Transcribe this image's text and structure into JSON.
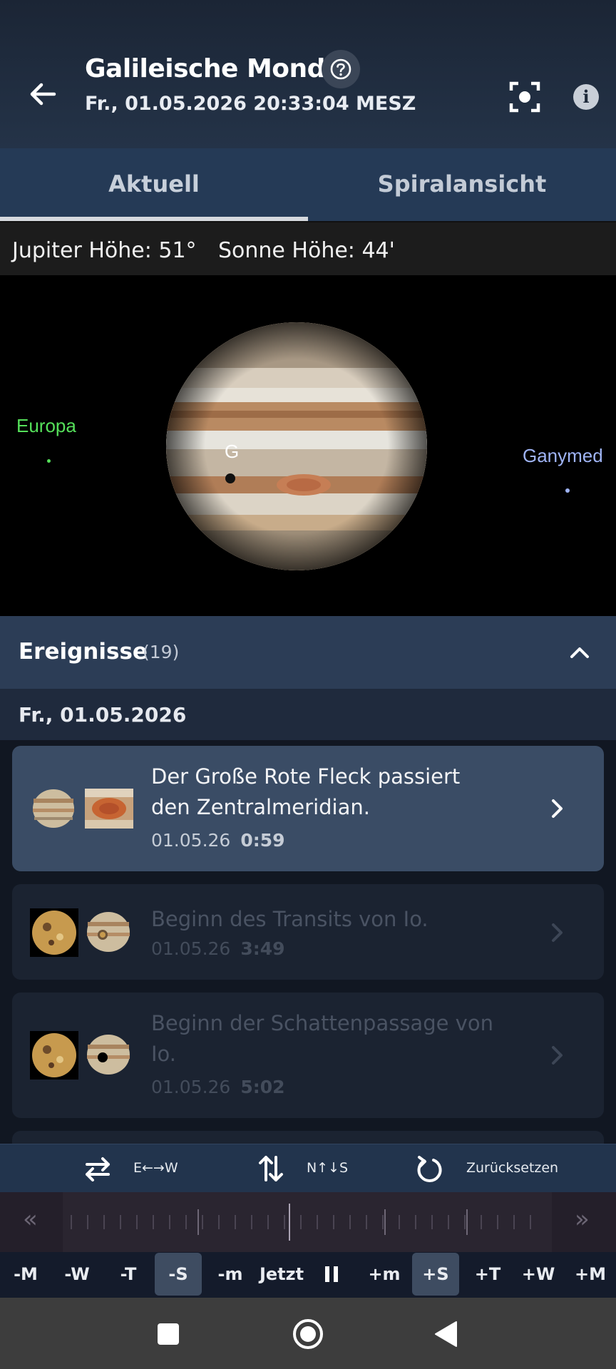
{
  "header": {
    "title": "Galileische Monde",
    "subtitle": "Fr., 01.05.2026 20:33:04 MESZ",
    "help_icon": "question-circle-icon",
    "focus_icon": "focus-frame-icon",
    "info_icon": "info-icon",
    "info_glyph": "i"
  },
  "tabs": [
    {
      "label": "Aktuell",
      "active": true
    },
    {
      "label": "Spiralansicht",
      "active": false
    }
  ],
  "altitude": {
    "jupiter": "Jupiter Höhe: 51°",
    "sun": "Sonne Höhe: 44'"
  },
  "sky": {
    "moons": [
      {
        "name": "Europa",
        "color": "#55e05a"
      },
      {
        "name": "Ganymed",
        "color": "#9fb4f5"
      }
    ],
    "transit_marker": "G"
  },
  "events": {
    "title": "Ereignisse",
    "count": "(19)",
    "date_header": "Fr., 01.05.2026",
    "items": [
      {
        "text_line1": "Der Große Rote Fleck passiert",
        "text_line2": "den Zentralmeridian.",
        "date": "01.05.26",
        "time": "0:59",
        "active": true
      },
      {
        "text_line1": "Beginn des Transits von Io.",
        "text_line2": "",
        "date": "01.05.26",
        "time": "3:49",
        "active": false
      },
      {
        "text_line1": "Beginn der Schattenpassage von",
        "text_line2": "Io.",
        "date": "01.05.26",
        "time": "5:02",
        "active": false
      }
    ]
  },
  "controls": {
    "flip_ew": "E←→W",
    "flip_ns": "N↑↓S",
    "reset": "Zurücksetzen"
  },
  "ruler": {
    "left_arrow": "«",
    "right_arrow": "»"
  },
  "steps": [
    "-M",
    "-W",
    "-T",
    "-S",
    "-m",
    "Jetzt",
    "+m",
    "+S",
    "+T",
    "+W",
    "+M"
  ],
  "selected_steps": [
    "-S",
    "+S"
  ],
  "colors": {
    "accent": "#253a56",
    "header": "#1b2535"
  }
}
